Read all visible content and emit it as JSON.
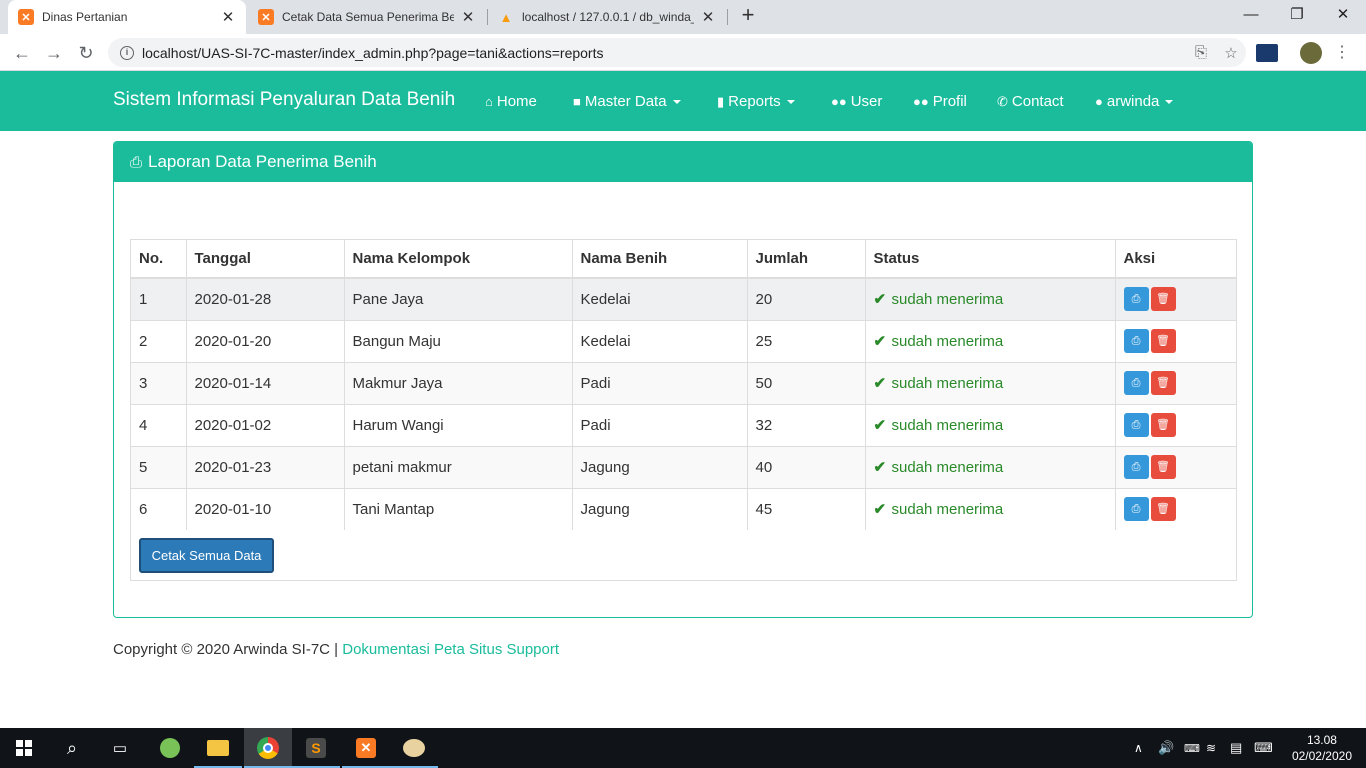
{
  "browser": {
    "tabs": [
      {
        "title": "Dinas Pertanian",
        "icon": "xampp-icon",
        "active": true
      },
      {
        "title": "Cetak Data Semua Penerima Beni",
        "icon": "xampp-icon",
        "active": false
      },
      {
        "title": "localhost / 127.0.0.1 / db_winda_",
        "icon": "phpmyadmin-icon",
        "active": false
      }
    ],
    "url": "localhost/UAS-SI-7C-master/index_admin.php?page=tani&actions=reports"
  },
  "navbar": {
    "brand": "Sistem Informasi Penyaluran Data Benih",
    "items": [
      {
        "label": "Home",
        "icon": "home-icon"
      },
      {
        "label": "Master Data",
        "icon": "folder-icon",
        "dropdown": true
      },
      {
        "label": "Reports",
        "icon": "file-icon",
        "dropdown": true
      },
      {
        "label": "User",
        "icon": "users-icon"
      },
      {
        "label": "Profil",
        "icon": "users-icon"
      },
      {
        "label": "Contact",
        "icon": "phone-icon"
      },
      {
        "label": "arwinda",
        "icon": "user-icon",
        "dropdown": true
      }
    ],
    "color": "#1abc9c"
  },
  "panel": {
    "title": "Laporan Data Penerima Benih",
    "headers": [
      "No.",
      "Tanggal",
      "Nama Kelompok",
      "Nama Benih",
      "Jumlah",
      "Status",
      "Aksi"
    ],
    "rows": [
      {
        "no": "1",
        "tanggal": "2020-01-28",
        "kelompok": "Pane Jaya",
        "benih": "Kedelai",
        "jumlah": "20",
        "status": "sudah menerima"
      },
      {
        "no": "2",
        "tanggal": "2020-01-20",
        "kelompok": "Bangun Maju",
        "benih": "Kedelai",
        "jumlah": "25",
        "status": "sudah menerima"
      },
      {
        "no": "3",
        "tanggal": "2020-01-14",
        "kelompok": "Makmur Jaya",
        "benih": "Padi",
        "jumlah": "50",
        "status": "sudah menerima"
      },
      {
        "no": "4",
        "tanggal": "2020-01-02",
        "kelompok": "Harum Wangi",
        "benih": "Padi",
        "jumlah": "32",
        "status": "sudah menerima"
      },
      {
        "no": "5",
        "tanggal": "2020-01-23",
        "kelompok": "petani makmur",
        "benih": "Jagung",
        "jumlah": "40",
        "status": "sudah menerima"
      },
      {
        "no": "6",
        "tanggal": "2020-01-10",
        "kelompok": "Tani Mantap",
        "benih": "Jagung",
        "jumlah": "45",
        "status": "sudah menerima"
      }
    ],
    "print_all_label": "Cetak Semua Data"
  },
  "footer": {
    "text": "Copyright © 2020 Arwinda SI-7C | ",
    "links": "Dokumentasi Peta Situs Support"
  },
  "taskbar": {
    "time": "13.08",
    "date": "02/02/2020"
  }
}
